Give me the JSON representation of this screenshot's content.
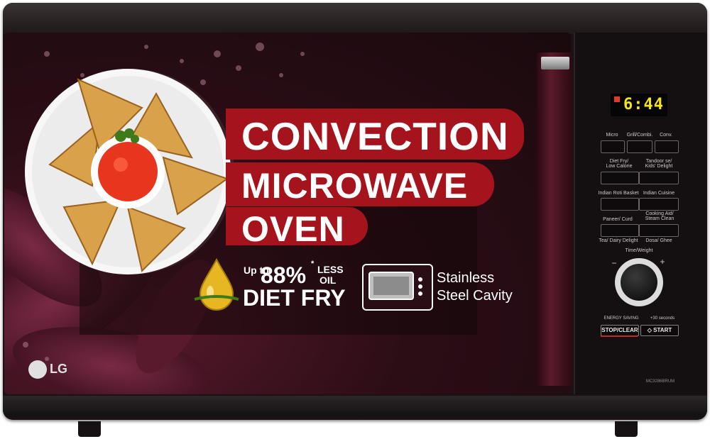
{
  "product": {
    "brand": "LG",
    "model": "MC3286BRUM"
  },
  "headline": {
    "line1": "CONVECTION",
    "line2": "MICROWAVE",
    "line3": "OVEN"
  },
  "features": {
    "oil": {
      "up_to": "Up to",
      "percent": "88%",
      "asterisk": "*",
      "less": "LESS",
      "oil": "OIL",
      "diet_fry": "DIET FRY"
    },
    "cavity": {
      "line1": "Stainless",
      "line2": "Steel Cavity"
    }
  },
  "panel": {
    "display": "6:44",
    "row1": [
      "Micro",
      "Grill/Combi.",
      "Conv."
    ],
    "row2_labels": [
      "Diet Fry/\nLow Calorie",
      "Tandoor se/\nKids' Delight"
    ],
    "row3_labels": [
      "Indian Roti Basket",
      "Indian Cuisine"
    ],
    "row4_labels": [
      "Paneer/ Curd",
      "Cooking Aid/\nSteam Clean"
    ],
    "row5_labels": [
      "Tea/ Dairy Delight",
      "Dosa/ Ghee"
    ],
    "knob_label": "Time/Weight",
    "minus": "−",
    "plus": "+",
    "energy_saving": "ENERGY SAVING",
    "plus30": "+30 seconds",
    "stop_clear": "STOP/CLEAR",
    "start": "START"
  },
  "colors": {
    "banner_red": "#a5141c",
    "display_yellow": "#f6e21a",
    "door_maroon": "#2c0d16"
  }
}
